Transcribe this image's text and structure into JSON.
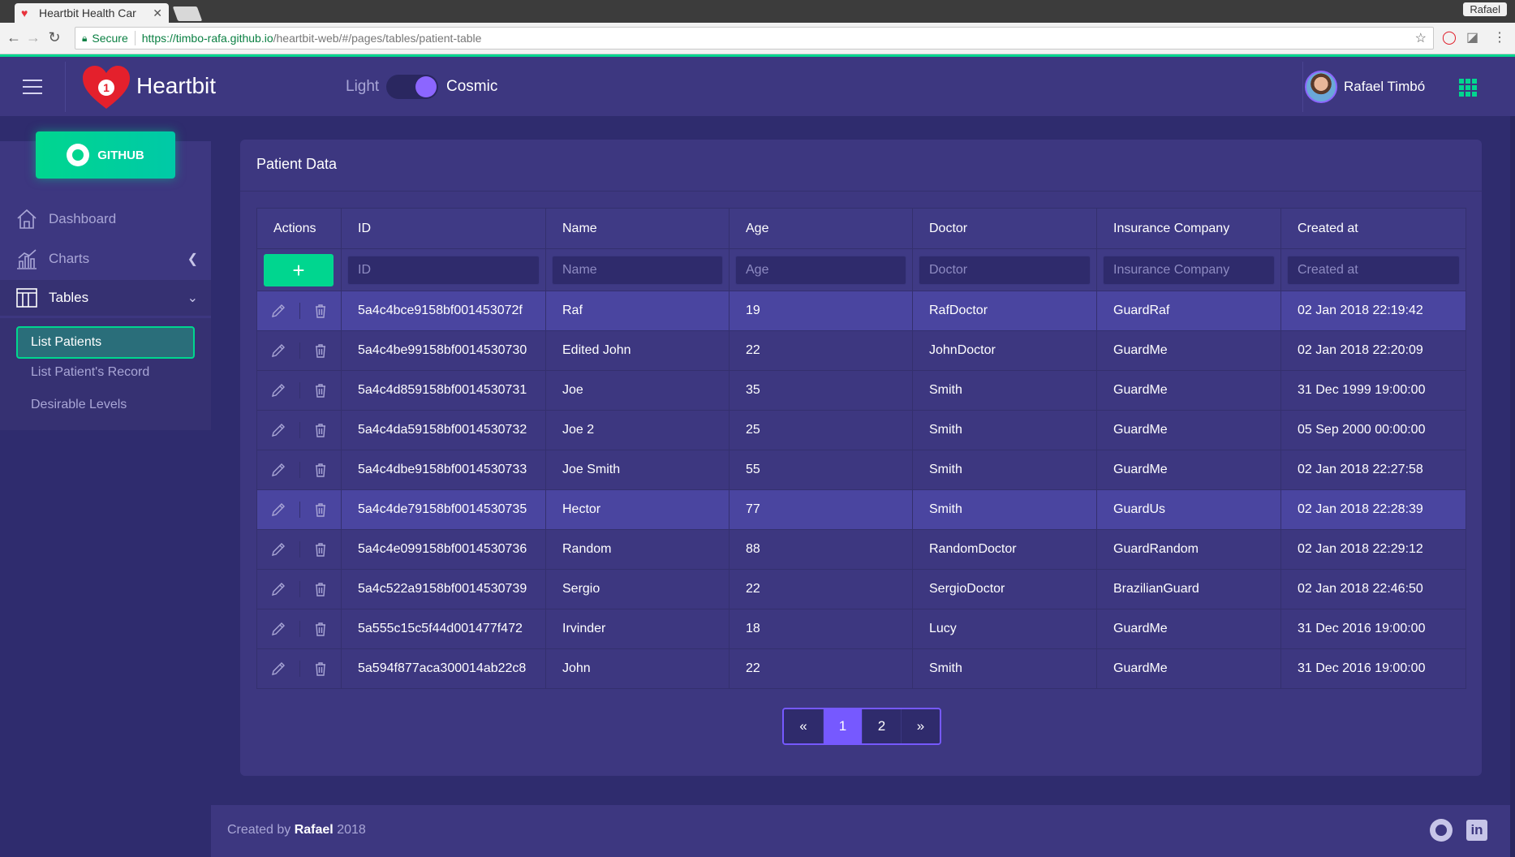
{
  "browser": {
    "tab_title": "Heartbit Health Car",
    "profile": "Rafael",
    "secure_label": "Secure",
    "url_host": "https://timbo-rafa.github.io",
    "url_path": "/heartbit-web/#/pages/tables/patient-table"
  },
  "header": {
    "brand": "Heartbit",
    "notification_count": "1",
    "theme_light": "Light",
    "theme_cosmic": "Cosmic",
    "user_name": "Rafael Timbó"
  },
  "sidebar": {
    "github_label": "GITHUB",
    "items": [
      {
        "label": "Dashboard",
        "icon": "home-icon"
      },
      {
        "label": "Charts",
        "icon": "bar-chart-icon"
      },
      {
        "label": "Tables",
        "icon": "table-icon"
      }
    ],
    "subitems": [
      {
        "label": "List Patients"
      },
      {
        "label": "List Patient's Record"
      },
      {
        "label": "Desirable Levels"
      }
    ]
  },
  "card": {
    "title": "Patient Data"
  },
  "table": {
    "columns": [
      "Actions",
      "ID",
      "Name",
      "Age",
      "Doctor",
      "Insurance Company",
      "Created at"
    ],
    "filters": [
      "ID",
      "Name",
      "Age",
      "Doctor",
      "Insurance Company",
      "Created at"
    ],
    "rows": [
      {
        "id": "5a4c4bce9158bf001453072f",
        "name": "Raf",
        "age": "19",
        "doctor": "RafDoctor",
        "insurance": "GuardRaf",
        "created": "02 Jan 2018 22:19:42"
      },
      {
        "id": "5a4c4be99158bf0014530730",
        "name": "Edited John",
        "age": "22",
        "doctor": "JohnDoctor",
        "insurance": "GuardMe",
        "created": "02 Jan 2018 22:20:09"
      },
      {
        "id": "5a4c4d859158bf0014530731",
        "name": "Joe",
        "age": "35",
        "doctor": "Smith",
        "insurance": "GuardMe",
        "created": "31 Dec 1999 19:00:00"
      },
      {
        "id": "5a4c4da59158bf0014530732",
        "name": "Joe 2",
        "age": "25",
        "doctor": "Smith",
        "insurance": "GuardMe",
        "created": "05 Sep 2000 00:00:00"
      },
      {
        "id": "5a4c4dbe9158bf0014530733",
        "name": "Joe Smith",
        "age": "55",
        "doctor": "Smith",
        "insurance": "GuardMe",
        "created": "02 Jan 2018 22:27:58"
      },
      {
        "id": "5a4c4de79158bf0014530735",
        "name": "Hector",
        "age": "77",
        "doctor": "Smith",
        "insurance": "GuardUs",
        "created": "02 Jan 2018 22:28:39"
      },
      {
        "id": "5a4c4e099158bf0014530736",
        "name": "Random",
        "age": "88",
        "doctor": "RandomDoctor",
        "insurance": "GuardRandom",
        "created": "02 Jan 2018 22:29:12"
      },
      {
        "id": "5a4c522a9158bf0014530739",
        "name": "Sergio",
        "age": "22",
        "doctor": "SergioDoctor",
        "insurance": "BrazilianGuard",
        "created": "02 Jan 2018 22:46:50"
      },
      {
        "id": "5a555c15c5f44d001477f472",
        "name": "Irvinder",
        "age": "18",
        "doctor": "Lucy",
        "insurance": "GuardMe",
        "created": "31 Dec 2016 19:00:00"
      },
      {
        "id": "5a594f877aca300014ab22c8",
        "name": "John",
        "age": "22",
        "doctor": "Smith",
        "insurance": "GuardMe",
        "created": "31 Dec 2016 19:00:00"
      }
    ]
  },
  "pagination": {
    "prev": "«",
    "pages": [
      "1",
      "2"
    ],
    "current": "1",
    "next": "»"
  },
  "footer": {
    "prefix": "Created by",
    "author": "Rafael",
    "year": "2018"
  },
  "colors": {
    "accent": "#00d68f",
    "primary": "#7659ff",
    "background": "#2f2c6e",
    "card": "#3d3780"
  }
}
